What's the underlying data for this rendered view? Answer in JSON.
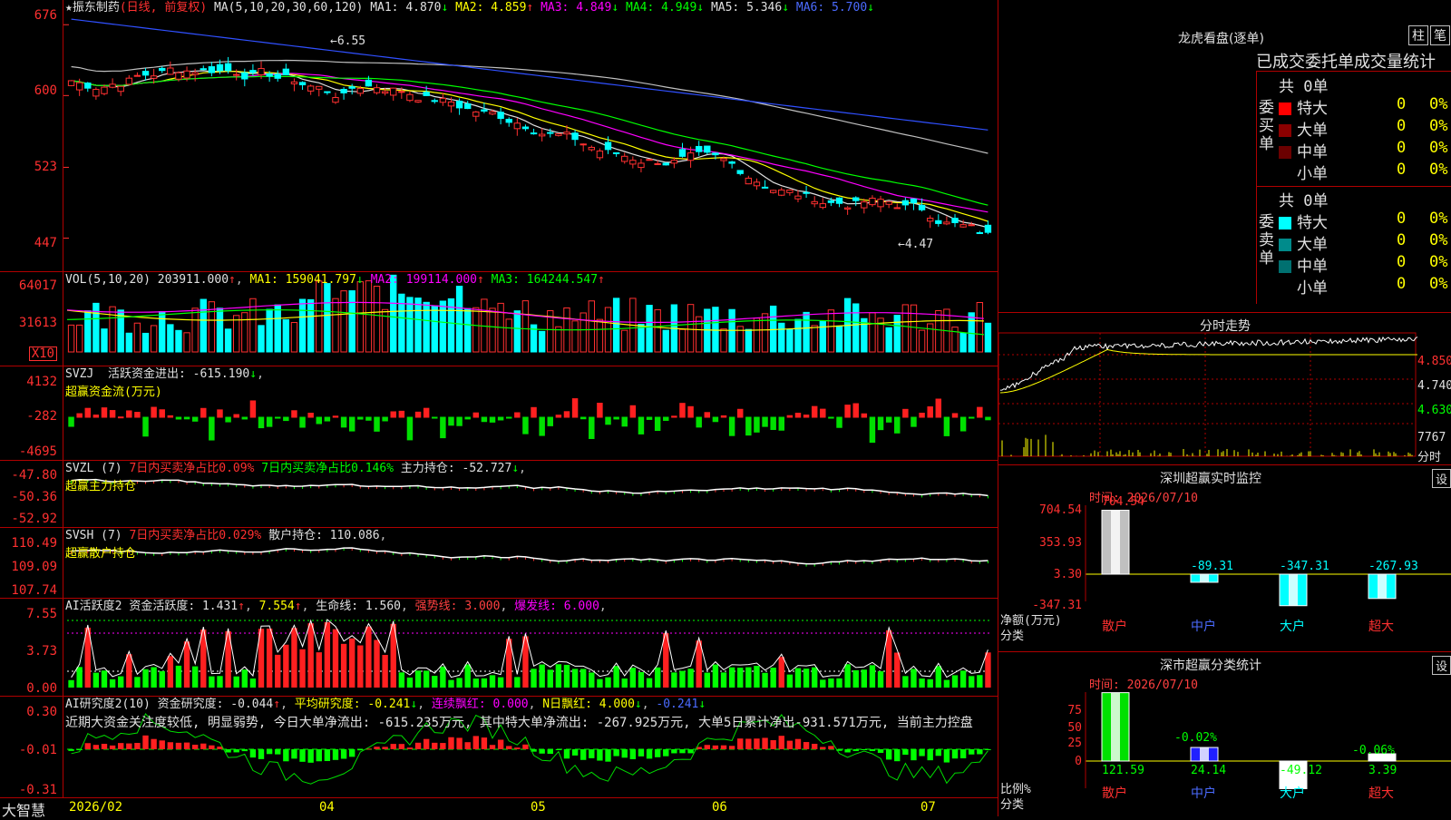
{
  "app": {
    "name": "大智慧"
  },
  "chart_data": [
    {
      "type": "candlestick",
      "name": "k-line",
      "title": "振东制药",
      "period": "(日线, 前复权)",
      "indicator": "MA(5,10,20,30,60,120)",
      "ma_values": [
        {
          "label": "MA1:",
          "value": "4.870",
          "arrow": "↓",
          "color": "#e0e0e0"
        },
        {
          "label": "MA2:",
          "value": "4.859",
          "arrow": "↑",
          "color": "#ffff00"
        },
        {
          "label": "MA3:",
          "value": "4.849",
          "arrow": "↓",
          "color": "#ff00ff"
        },
        {
          "label": "MA4:",
          "value": "4.949",
          "arrow": "↓",
          "color": "#00ff00"
        },
        {
          "label": "MA5:",
          "value": "5.346",
          "arrow": "↓",
          "color": "#e0e0e0"
        },
        {
          "label": "MA6:",
          "value": "5.700",
          "arrow": "↓",
          "color": "#4b6bff"
        }
      ],
      "y_ticks": [
        "676",
        "600",
        "523",
        "447"
      ],
      "y_tick_values": [
        6.76,
        6.0,
        5.23,
        4.47
      ],
      "ylim": [
        4.3,
        6.85
      ],
      "high_label": "6.55",
      "low_label": "4.47",
      "x_labels": [
        "2026/02",
        "04",
        "05",
        "06",
        "07"
      ]
    },
    {
      "type": "bar",
      "name": "volume",
      "header": "VOL(5,10,20)",
      "value": "203911.000",
      "mas": [
        {
          "label": "MA1:",
          "value": "159041.797",
          "arrow": "↓",
          "color": "#ffff00"
        },
        {
          "label": "MA2:",
          "value": "199114.000",
          "arrow": "↑",
          "color": "#ff00ff"
        },
        {
          "label": "MA3:",
          "value": "164244.547",
          "arrow": "↑",
          "color": "#00ff00"
        }
      ],
      "y_ticks": [
        "64017",
        "31613"
      ],
      "unit": "X10"
    },
    {
      "type": "bar",
      "name": "svzj",
      "header": "SVZJ",
      "label": "活跃资金进出:",
      "value": "-615.190",
      "sub": "超赢资金流(万元)",
      "y_ticks": [
        "4132",
        "-282",
        "-4695"
      ]
    },
    {
      "type": "line",
      "name": "svzl",
      "header": "SVZL (7)",
      "p1": "7日内买卖净占比0.09%",
      "p2": "7日内买卖净占比0.146%",
      "p3": "主力持仓: -52.727",
      "sub": "超赢主力持仓",
      "y_ticks": [
        "-47.80",
        "-50.36",
        "-52.92"
      ]
    },
    {
      "type": "line",
      "name": "svsh",
      "header": "SVSH (7)",
      "p1": "7日内买卖净占比0.029%",
      "p2": "散户持仓: 110.086",
      "sub": "超赢散户持仓",
      "y_ticks": [
        "110.49",
        "109.09",
        "107.74"
      ]
    },
    {
      "type": "bar",
      "name": "ai-activity",
      "header": "AI活跃度2",
      "p1": "资金活跃度: 1.431",
      "p2": "7.554",
      "p3": "生命线: 1.560",
      "p4": "强势线: 3.000",
      "p5": "爆发线: 6.000",
      "y_ticks": [
        "7.55",
        "3.73",
        "0.00"
      ]
    },
    {
      "type": "bar",
      "name": "ai-research",
      "header": "AI研究度2(10)",
      "p1": "资金研究度: -0.044",
      "p2": "平均研究度: -0.241",
      "p3": "连续飘红: 0.000",
      "p4": "N日飘红: 4.000",
      "p5": "-0.241",
      "note": "近期大资金关注度较低, 明显弱势, 今日大单净流出: -615.235万元, 其中特大单净流出: -267.925万元, 大单5日累计净出-931.571万元, 当前主力控盘",
      "y_ticks": [
        "0.30",
        "-0.01",
        "-0.31"
      ]
    },
    {
      "type": "line",
      "name": "intraday",
      "title": "分时走势",
      "y_ticks": [
        "4.850",
        "4.740",
        "4.630"
      ],
      "vol_label": "7767",
      "vol_sub": "分时"
    },
    {
      "type": "bar",
      "name": "sz-monitor",
      "title": "深圳超赢实时监控",
      "time": "时间: 2026/07/10",
      "categories": [
        "散户",
        "中户",
        "大户",
        "超大"
      ],
      "values": [
        704.54,
        -89.31,
        -347.31,
        -267.93
      ],
      "value_labels": [
        "704.54",
        "-89.31",
        "-347.31",
        "-267.93"
      ],
      "y_ticks": [
        "704.54",
        "353.93",
        "3.30",
        "-347.31"
      ],
      "ylabel": "净额(万元)",
      "xlabel": "分类",
      "button": "设"
    },
    {
      "type": "bar",
      "name": "sz-class",
      "title": "深市超赢分类统计",
      "time": "时间: 2026/07/10",
      "categories": [
        "散户",
        "中户",
        "大户",
        "超大"
      ],
      "values": [
        121.59,
        24.14,
        -49.12,
        3.39
      ],
      "value_labels": [
        "121.59",
        "24.14",
        "-49.12",
        "3.39"
      ],
      "pct_labels": [
        "-0.02%",
        "-0.06%"
      ],
      "y_ticks": [
        "75",
        "50",
        "25",
        "0"
      ],
      "ylabel": "比例%",
      "xlabel": "分类",
      "button": "设"
    }
  ],
  "dragon": {
    "title": "龙虎看盘(逐单)",
    "btn1": "柱",
    "btn2": "笔",
    "subtitle": "已成交委托单成交量统计",
    "buy": {
      "count": "共 0单",
      "side": "委买单",
      "rows": [
        {
          "label": "特大",
          "n": "0",
          "p": "0%",
          "color": "#ff0000"
        },
        {
          "label": "大单",
          "n": "0",
          "p": "0%",
          "color": "#8b0000"
        },
        {
          "label": "中单",
          "n": "0",
          "p": "0%",
          "color": "#6b0000"
        },
        {
          "label": "小单",
          "n": "0",
          "p": "0%",
          "color": "#000000"
        }
      ]
    },
    "sell": {
      "count": "共 0单",
      "side": "委卖单",
      "rows": [
        {
          "label": "特大",
          "n": "0",
          "p": "0%",
          "color": "#00ffff"
        },
        {
          "label": "大单",
          "n": "0",
          "p": "0%",
          "color": "#008b8b"
        },
        {
          "label": "中单",
          "n": "0",
          "p": "0%",
          "color": "#007070"
        },
        {
          "label": "小单",
          "n": "0",
          "p": "0%",
          "color": "#000000"
        }
      ]
    }
  }
}
